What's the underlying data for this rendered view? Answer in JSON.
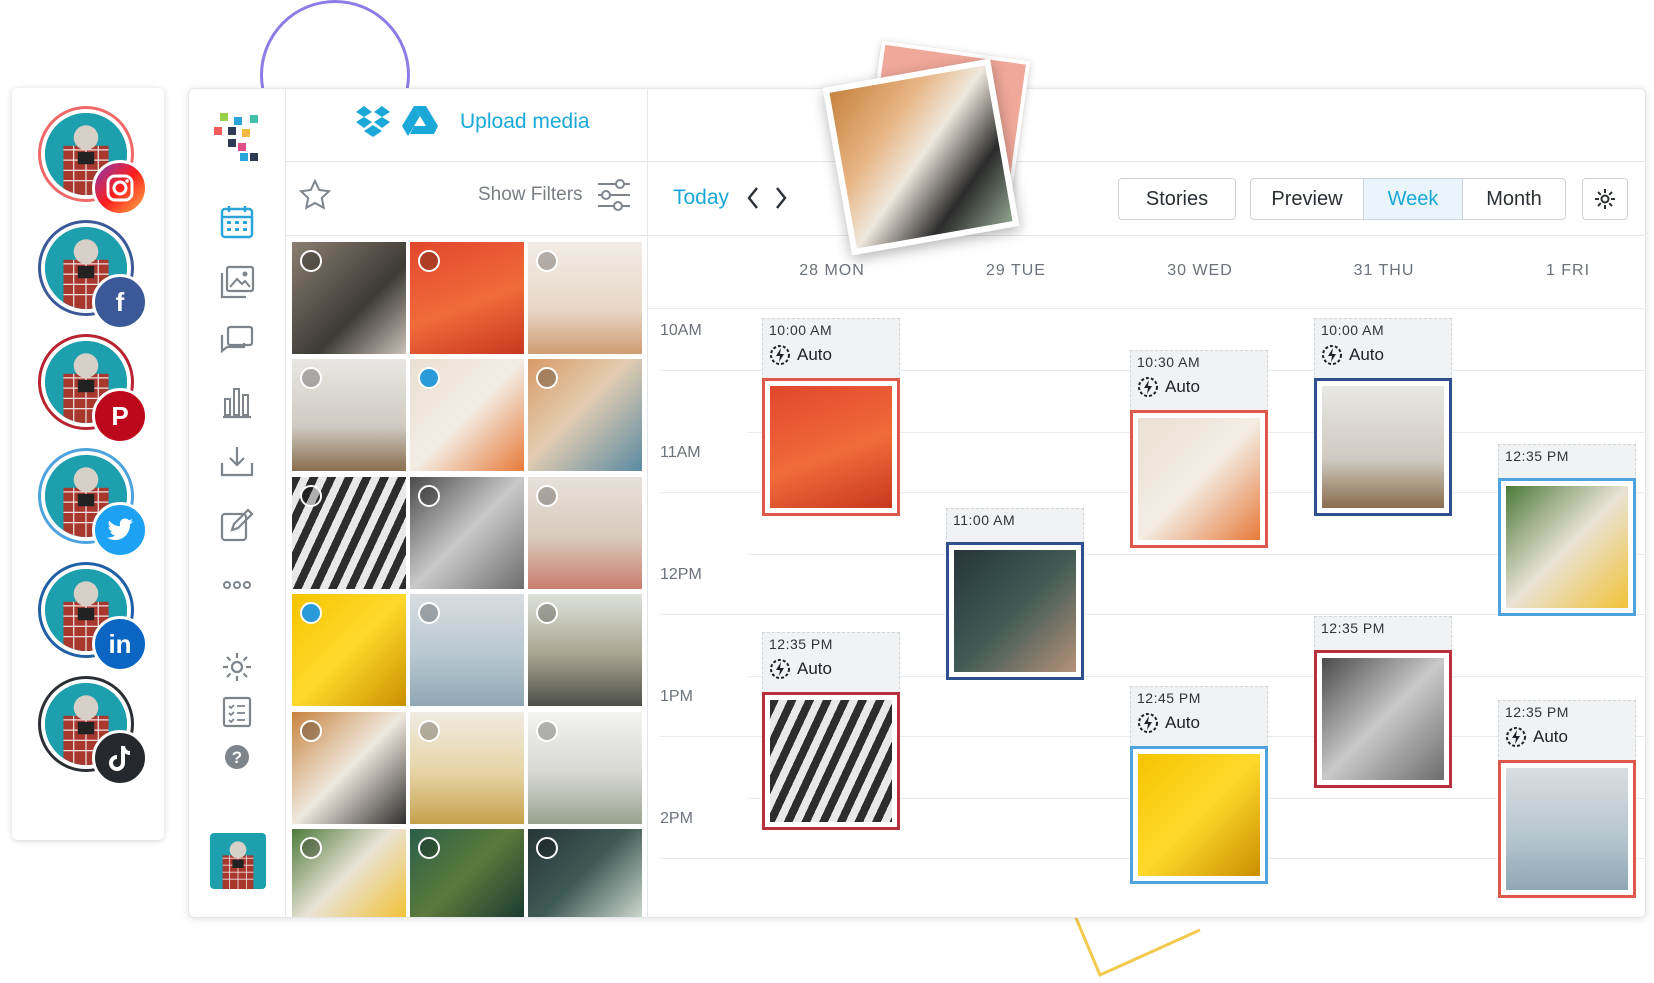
{
  "upload": {
    "label": "Upload media"
  },
  "filters": {
    "label": "Show Filters"
  },
  "calendar": {
    "today_label": "Today",
    "buttons": {
      "stories": "Stories",
      "preview": "Preview",
      "week": "Week",
      "month": "Month"
    },
    "days": [
      "28 MON",
      "29 TUE",
      "30 WED",
      "31 THU",
      "1 FRI"
    ],
    "hours": [
      "10AM",
      "11AM",
      "12PM",
      "1PM",
      "2PM"
    ],
    "posts": [
      {
        "time": "10:00 AM",
        "auto": "Auto",
        "color": "#e0584c"
      },
      {
        "time": "12:35 PM",
        "auto": "Auto",
        "color": "#b9303c"
      },
      {
        "time": "11:00 AM",
        "auto": "",
        "color": "#2f4f8f"
      },
      {
        "time": "10:30 AM",
        "auto": "Auto",
        "color": "#e0584c"
      },
      {
        "time": "12:45 PM",
        "auto": "Auto",
        "color": "#4da3dd"
      },
      {
        "time": "10:00 AM",
        "auto": "Auto",
        "color": "#2f4f8f"
      },
      {
        "time": "12:35 PM",
        "auto": "",
        "color": "#b9303c"
      },
      {
        "time": "12:35 PM",
        "auto": "",
        "color": "#4da3dd"
      },
      {
        "time": "12:35 PM",
        "auto": "Auto",
        "color": "#e0584c"
      }
    ]
  },
  "accounts": [
    {
      "network": "instagram-icon",
      "color": "#e1306c"
    },
    {
      "network": "facebook-icon",
      "color": "#3b5998"
    },
    {
      "network": "pinterest-icon",
      "color": "#bd081c"
    },
    {
      "network": "twitter-icon",
      "color": "#1da1f2"
    },
    {
      "network": "linkedin-icon",
      "color": "#0a66c2"
    },
    {
      "network": "tiktok-icon",
      "color": "#25282c"
    }
  ],
  "colors": {
    "accent": "#1aa8d8",
    "border": "#e3e6ea"
  }
}
